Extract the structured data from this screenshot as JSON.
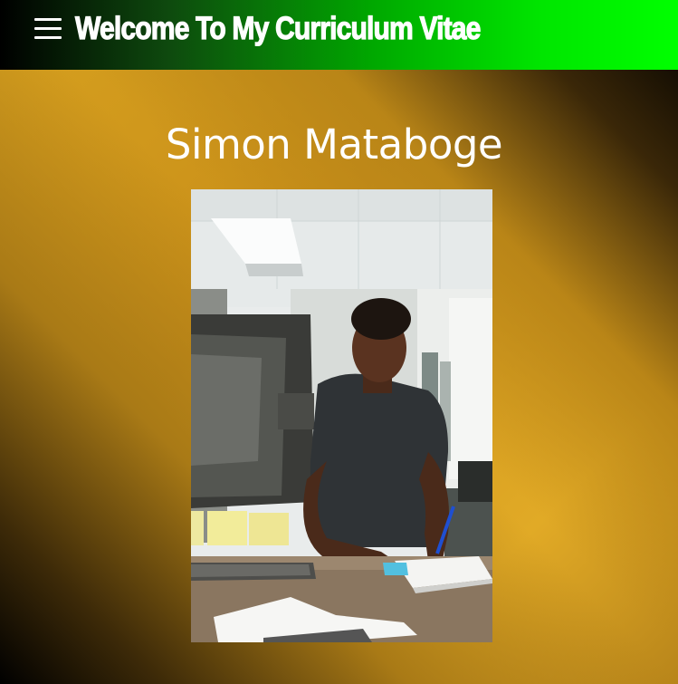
{
  "header": {
    "menu_icon": "hamburger-menu-icon",
    "title": "Welcome To My Curriculum Vitae",
    "colors": {
      "gradient_start": "#000000",
      "gradient_end": "#00ff00"
    }
  },
  "main": {
    "name": "Simon Mataboge",
    "photo": {
      "description_icon": "profile-photo"
    }
  },
  "theme": {
    "background_gold": "#dba321",
    "background_dark": "#000000",
    "text_color": "#ffffff"
  }
}
